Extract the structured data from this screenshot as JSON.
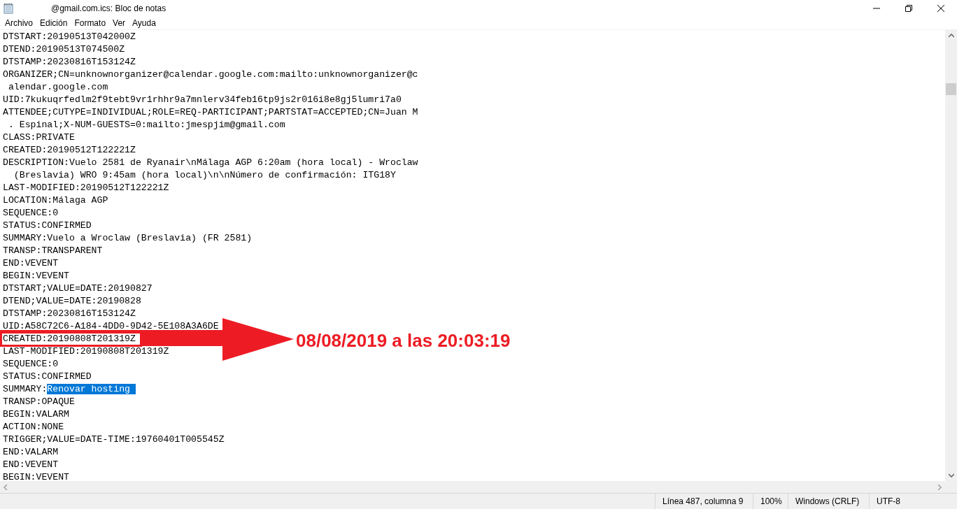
{
  "window": {
    "title": "@gmail.com.ics: Bloc de notas"
  },
  "menu": [
    {
      "label": "Archivo"
    },
    {
      "label": "Edición"
    },
    {
      "label": "Formato"
    },
    {
      "label": "Ver"
    },
    {
      "label": "Ayuda"
    }
  ],
  "lines": [
    {
      "text": "DTSTART:20190513T042000Z",
      "boxed": false
    },
    {
      "text": "DTEND:20190513T074500Z",
      "boxed": false
    },
    {
      "text": "DTSTAMP:20230816T153124Z",
      "boxed": false
    },
    {
      "text": "ORGANIZER;CN=unknownorganizer@calendar.google.com:mailto:unknownorganizer@c",
      "boxed": false
    },
    {
      "text": " alendar.google.com",
      "boxed": false
    },
    {
      "text": "UID:7kukuqrfedlm2f9tebt9vr1rhhr9a7mnlerv34feb16tp9js2r016i8e8gj5lumri7a0",
      "boxed": false
    },
    {
      "text": "ATTENDEE;CUTYPE=INDIVIDUAL;ROLE=REQ-PARTICIPANT;PARTSTAT=ACCEPTED;CN=Juan M",
      "boxed": false
    },
    {
      "text": " . Espinal;X-NUM-GUESTS=0:mailto:jmespjim@gmail.com",
      "boxed": false
    },
    {
      "text": "CLASS:PRIVATE",
      "boxed": false
    },
    {
      "text": "CREATED:20190512T122221Z",
      "boxed": false
    },
    {
      "text": "DESCRIPTION:Vuelo 2581 de Ryanair\\nMálaga AGP 6:20am (hora local) - Wroclaw",
      "boxed": false
    },
    {
      "text": "  (Breslavia) WRO 9:45am (hora local)\\n\\nNúmero de confirmación: ITG18Y",
      "boxed": false
    },
    {
      "text": "LAST-MODIFIED:20190512T122221Z",
      "boxed": false
    },
    {
      "text": "LOCATION:Málaga AGP",
      "boxed": false
    },
    {
      "text": "SEQUENCE:0",
      "boxed": false
    },
    {
      "text": "STATUS:CONFIRMED",
      "boxed": false
    },
    {
      "text": "SUMMARY:Vuelo a Wroclaw (Breslavia) (FR 2581)",
      "boxed": false
    },
    {
      "text": "TRANSP:TRANSPARENT",
      "boxed": false
    },
    {
      "text": "END:VEVENT",
      "boxed": false
    },
    {
      "text": "BEGIN:VEVENT",
      "boxed": false
    },
    {
      "text": "DTSTART;VALUE=DATE:20190827",
      "boxed": false
    },
    {
      "text": "DTEND;VALUE=DATE:20190828",
      "boxed": false
    },
    {
      "text": "DTSTAMP:20230816T153124Z",
      "boxed": false
    },
    {
      "text": "UID:A58C72C6-A184-4DD0-9D42-5E108A3A6DE",
      "boxed": false
    },
    {
      "text": "CREATED:20190808T201319Z",
      "boxed": true
    },
    {
      "text": "LAST-MODIFIED:20190808T201319Z",
      "boxed": false
    },
    {
      "text": "SEQUENCE:0",
      "boxed": false
    },
    {
      "text": "STATUS:CONFIRMED",
      "boxed": false
    },
    {
      "text": "SUMMARY:",
      "selected_text": "Renovar hosting ",
      "boxed": false
    },
    {
      "text": "TRANSP:OPAQUE",
      "boxed": false
    },
    {
      "text": "BEGIN:VALARM",
      "boxed": false
    },
    {
      "text": "ACTION:NONE",
      "boxed": false
    },
    {
      "text": "TRIGGER;VALUE=DATE-TIME:19760401T005545Z",
      "boxed": false
    },
    {
      "text": "END:VALARM",
      "boxed": false
    },
    {
      "text": "END:VEVENT",
      "boxed": false
    },
    {
      "text": "BEGIN:VEVENT",
      "boxed": false
    }
  ],
  "annotation": {
    "text": "08/08/2019 a las 20:03:19"
  },
  "status_bar": [
    {
      "text": "Línea 487, columna 9"
    },
    {
      "text": "100%"
    },
    {
      "text": "Windows (CRLF)"
    },
    {
      "text": "UTF-8"
    }
  ]
}
